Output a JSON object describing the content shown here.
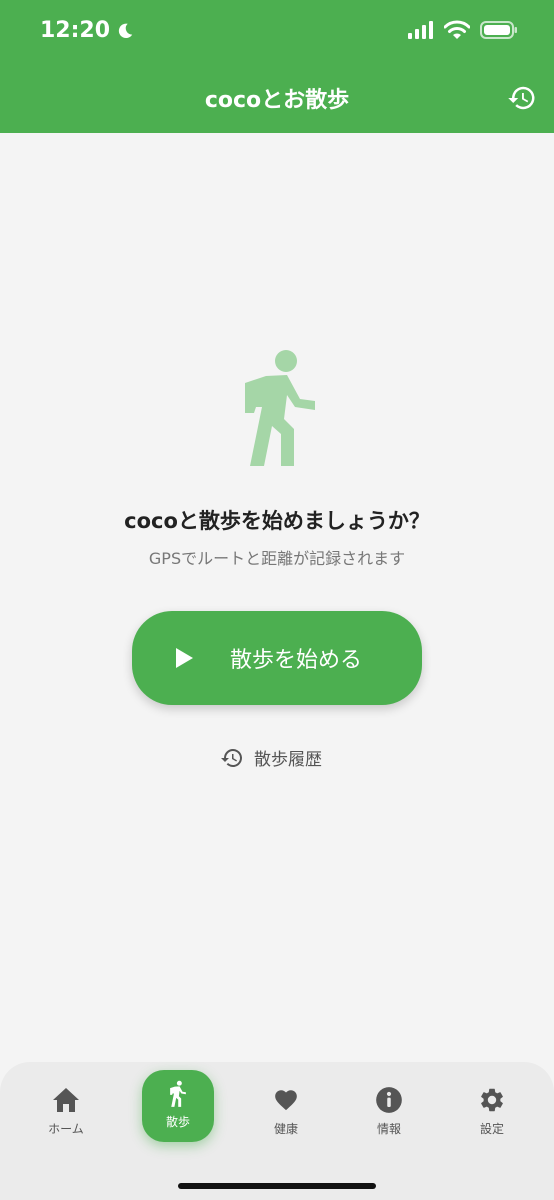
{
  "status": {
    "time": "12:20"
  },
  "header": {
    "title": "cocoとお散歩"
  },
  "main": {
    "prompt": "cocoと散歩を始めましょうか？",
    "subtitle": "GPSでルートと距離が記録されます",
    "start_label": "散歩を始める",
    "history_label": "散歩履歴"
  },
  "tabs": [
    {
      "label": "ホーム",
      "icon": "home-icon"
    },
    {
      "label": "散歩",
      "icon": "walk-icon"
    },
    {
      "label": "健康",
      "icon": "heart-icon"
    },
    {
      "label": "情報",
      "icon": "info-icon"
    },
    {
      "label": "設定",
      "icon": "gear-icon"
    }
  ],
  "colors": {
    "accent": "#4caf50",
    "accent_light": "#a5d6a7",
    "background": "#f4f4f4"
  }
}
